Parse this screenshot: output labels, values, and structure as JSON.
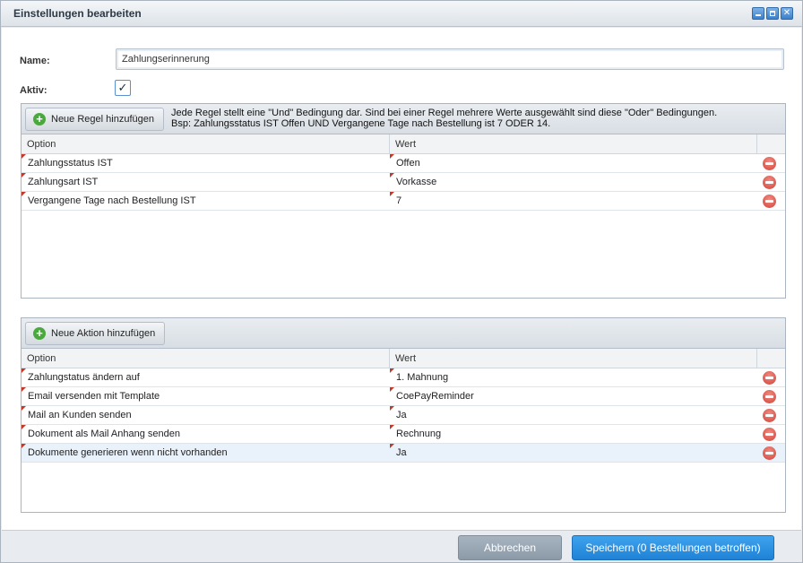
{
  "window": {
    "title": "Einstellungen bearbeiten"
  },
  "form": {
    "name_label": "Name:",
    "name_value": "Zahlungserinnerung",
    "active_label": "Aktiv:",
    "active_checked": "✓"
  },
  "rules": {
    "add_label": "Neue Regel hinzufügen",
    "hint_line1": "Jede Regel stellt eine \"Und\" Bedingung dar. Sind bei einer Regel mehrere Werte ausgewählt sind diese \"Oder\" Bedingungen.",
    "hint_line2": "Bsp: Zahlungsstatus IST Offen UND Vergangene Tage nach Bestellung ist 7 ODER 14.",
    "col_option": "Option",
    "col_value": "Wert",
    "rows": [
      {
        "option": "Zahlungsstatus IST",
        "value": "Offen"
      },
      {
        "option": "Zahlungsart IST",
        "value": "Vorkasse"
      },
      {
        "option": "Vergangene Tage nach Bestellung IST",
        "value": "7"
      }
    ]
  },
  "actions": {
    "add_label": "Neue Aktion hinzufügen",
    "col_option": "Option",
    "col_value": "Wert",
    "rows": [
      {
        "option": "Zahlungstatus ändern auf",
        "value": "1. Mahnung"
      },
      {
        "option": "Email versenden mit Template",
        "value": "CoePayReminder"
      },
      {
        "option": "Mail an Kunden senden",
        "value": "Ja"
      },
      {
        "option": "Dokument als Mail Anhang senden",
        "value": "Rechnung"
      },
      {
        "option": "Dokumente generieren wenn nicht vorhanden",
        "value": "Ja"
      }
    ]
  },
  "footer": {
    "cancel_label": "Abbrechen",
    "save_label": "Speichern (0 Bestellungen betroffen)"
  },
  "colors": {
    "accent": "#1f82d6",
    "remove": "#d3443a",
    "add": "#4aa93c"
  },
  "icons": [
    "minimize-icon",
    "maximize-icon",
    "close-icon",
    "plus-icon",
    "remove-icon",
    "checkmark-icon"
  ]
}
